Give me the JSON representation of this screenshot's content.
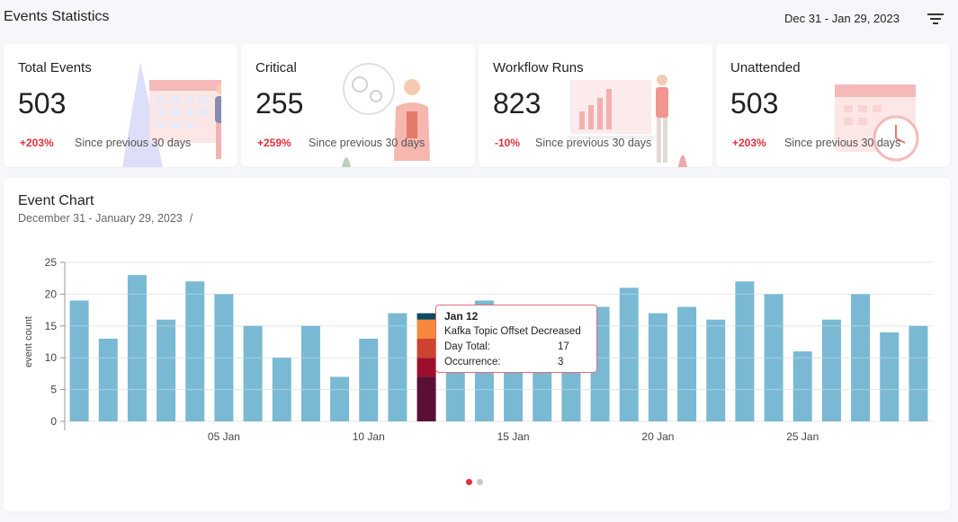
{
  "header": {
    "title": "Events Statistics",
    "date_range": "Dec 31 - Jan 29, 2023",
    "filter_icon": "filter-lines-icon"
  },
  "cards": [
    {
      "label": "Total Events",
      "value": "503",
      "delta": "+203%",
      "since": "Since previous 30 days",
      "delta_color": "#e0303b",
      "illustration": "calendar-person-illustration"
    },
    {
      "label": "Critical",
      "value": "255",
      "delta": "+259%",
      "since": "Since previous 30 days",
      "delta_color": "#e0303b",
      "illustration": "thinking-gears-illustration"
    },
    {
      "label": "Workflow Runs",
      "value": "823",
      "delta": "-10%",
      "since": "Since previous 30 days",
      "delta_color": "#e0303b",
      "illustration": "presentation-chart-illustration"
    },
    {
      "label": "Unattended",
      "value": "503",
      "delta": "+203%",
      "since": "Since previous 30 days",
      "delta_color": "#e0303b",
      "illustration": "calendar-clock-illustration"
    }
  ],
  "event_chart": {
    "title": "Event Chart",
    "subtitle": "December 31 - January 29, 2023",
    "subtitle_sep": "/",
    "pager": {
      "pages": 2,
      "active": 0
    }
  },
  "tooltip": {
    "date": "Jan 12",
    "event": "Kafka Topic Offset Decreased",
    "day_total_label": "Day Total:",
    "day_total": "17",
    "occurrence_label": "Occurrence:",
    "occurrence": "3"
  },
  "chart_data": {
    "type": "bar",
    "x": [
      "Dec 31",
      "Jan 01",
      "Jan 02",
      "Jan 03",
      "Jan 04",
      "Jan 05",
      "Jan 06",
      "Jan 07",
      "Jan 08",
      "Jan 09",
      "Jan 10",
      "Jan 11",
      "Jan 12",
      "Jan 13",
      "Jan 14",
      "Jan 15",
      "Jan 16",
      "Jan 17",
      "Jan 18",
      "Jan 19",
      "Jan 20",
      "Jan 21",
      "Jan 22",
      "Jan 23",
      "Jan 24",
      "Jan 25",
      "Jan 26",
      "Jan 27",
      "Jan 28",
      "Jan 29"
    ],
    "values": [
      19,
      13,
      23,
      16,
      22,
      20,
      15,
      10,
      15,
      7,
      13,
      17,
      17,
      18,
      19,
      17,
      17,
      17,
      18,
      21,
      17,
      18,
      16,
      22,
      20,
      11,
      16,
      20,
      14,
      15
    ],
    "ylabel": "event count",
    "ylim": [
      0,
      25
    ],
    "yticks": [
      0,
      5,
      10,
      15,
      20,
      25
    ],
    "xtick_labels": [
      "05 Jan",
      "10 Jan",
      "15 Jan",
      "20 Jan",
      "25 Jan"
    ],
    "xtick_indices": [
      5,
      10,
      15,
      20,
      25
    ],
    "grid": true,
    "bar_color": "#7ab9d3",
    "highlight": {
      "index": 12,
      "segments": [
        {
          "value": 7,
          "color": "#5a0f36"
        },
        {
          "value": 3,
          "color": "#9c0f2c"
        },
        {
          "value": 3,
          "color": "#cc4430"
        },
        {
          "value": 3,
          "color": "#f7873c"
        },
        {
          "value": 1,
          "color": "#0d4a5e"
        }
      ]
    }
  }
}
